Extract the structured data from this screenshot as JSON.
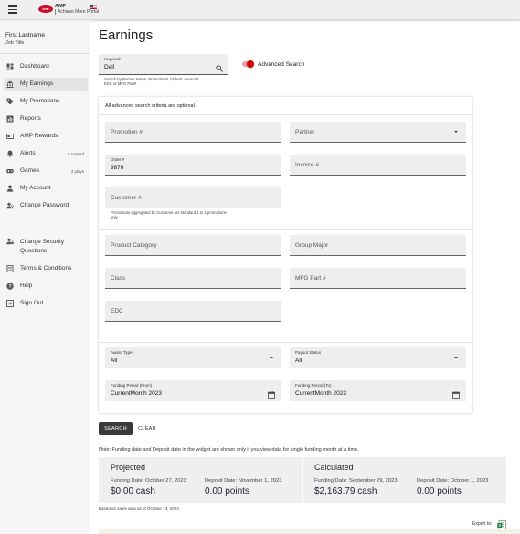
{
  "header": {
    "logo_text": "cmr",
    "brand_title": "AMP",
    "brand_subtitle": "Achieve More Portal",
    "icons": {
      "menu": "hamburger-menu-icon",
      "flag": "us-flag-icon"
    }
  },
  "user": {
    "name": "First Lastname",
    "title": "Job Title"
  },
  "sidebar": {
    "items": [
      {
        "label": "Dashboard",
        "icon": "dashboard-icon",
        "meta": ""
      },
      {
        "label": "My Earnings",
        "icon": "bank-icon",
        "meta": "",
        "active": true
      },
      {
        "label": "My Promotions",
        "icon": "tag-icon",
        "meta": ""
      },
      {
        "label": "Reports",
        "icon": "bar-chart-icon",
        "meta": ""
      },
      {
        "label": "AMP Rewards",
        "icon": "gift-card-icon",
        "meta": ""
      },
      {
        "label": "Alerts",
        "icon": "bell-icon",
        "meta": "5 unread"
      },
      {
        "label": "Games",
        "icon": "gamepad-icon",
        "meta": "3 plays"
      },
      {
        "label": "My Account",
        "icon": "person-icon",
        "meta": ""
      },
      {
        "label": "Change Password",
        "icon": "person-key-icon",
        "meta": ""
      },
      {
        "label": "Change Security Questions",
        "icon": "person-lock-icon",
        "meta": ""
      },
      {
        "label": "Terms & Conditions",
        "icon": "document-icon",
        "meta": ""
      },
      {
        "label": "Help",
        "icon": "help-icon",
        "meta": ""
      },
      {
        "label": "Sign Out",
        "icon": "exit-icon",
        "meta": ""
      }
    ]
  },
  "page": {
    "title": "Earnings"
  },
  "keyword": {
    "label": "Keyword",
    "value": "Dell",
    "hint": "Search by Partner Name, Promotion#, Order#, Invoice#, EDC or MFG Part#"
  },
  "advanced_toggle": {
    "label": "Advanced Search",
    "on": true
  },
  "advanced": {
    "note": "All advanced search criteria are optional",
    "promotion": {
      "placeholder": "Promotion #"
    },
    "partner": {
      "placeholder": "Partner"
    },
    "order": {
      "label": "Order #",
      "value": "9876"
    },
    "invoice": {
      "placeholder": "Invoice #"
    },
    "customer": {
      "placeholder": "Customer #",
      "hint": "Promotions aggregated by Customer are standard 1 to 1 promotions only."
    },
    "product_category": {
      "placeholder": "Product Category"
    },
    "group_major": {
      "placeholder": "Group Major"
    },
    "class": {
      "placeholder": "Class"
    },
    "mfg_part": {
      "placeholder": "MFG Part #"
    },
    "edc": {
      "placeholder": "EDC"
    },
    "award_type": {
      "label": "Award Type",
      "value": "All"
    },
    "payout_status": {
      "label": "Payout Status",
      "value": "All"
    },
    "funding_from": {
      "label": "Funding Period (From)",
      "value": "CurrentMonth 2023"
    },
    "funding_to": {
      "label": "Funding Period (To)",
      "value": "CurrentMonth 2023"
    }
  },
  "actions": {
    "search": "SEARCH",
    "clear": "CLEAR"
  },
  "note": "Note: Funding date and Deposit date in the widget are shown only if you view data for single funding month at a time.",
  "summary": {
    "projected": {
      "title": "Projected",
      "funding_date": "Funding Date: October 27, 2023",
      "cash": "$0.00 cash",
      "deposit_date": "Deposit Date: November 1, 2023",
      "points": "0.00 points"
    },
    "calculated": {
      "title": "Calculated",
      "funding_date": "Funding Date: September 29, 2023",
      "cash": "$2,163.79 cash",
      "deposit_date": "Deposit Date: October 1, 2023",
      "points": "0.00 points"
    },
    "based_on": "Based on sales data as of October 13, 2023"
  },
  "export": {
    "label": "Export to:",
    "icon": "excel-export-icon"
  },
  "colors": {
    "accent": "#d50000",
    "button": "#3a3a3a",
    "field_bg": "#eeeeee",
    "sidebar_bg": "#f5f5f5"
  }
}
